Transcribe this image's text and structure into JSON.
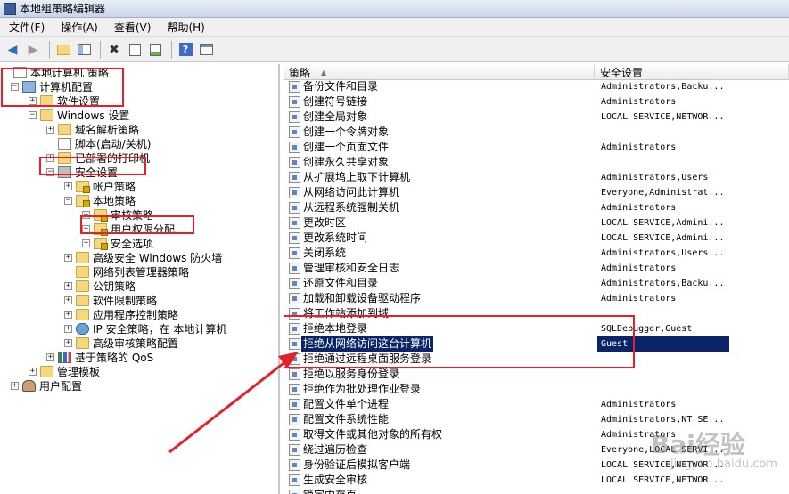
{
  "window": {
    "title": "本地组策略编辑器"
  },
  "menu": [
    "文件(F)",
    "操作(A)",
    "查看(V)",
    "帮助(H)"
  ],
  "toolbar_icons": [
    "back-arrow-icon",
    "forward-arrow-icon",
    "up-folder-icon",
    "show-hide-tree-icon",
    "delete-icon",
    "properties-icon",
    "export-list-icon",
    "help-icon",
    "view-icon"
  ],
  "tree": [
    {
      "label": "本地计算机 策略",
      "depth": 0,
      "expander": "",
      "icon": "doc"
    },
    {
      "label": "计算机配置",
      "depth": 1,
      "expander": "−",
      "icon": "pc"
    },
    {
      "label": "软件设置",
      "depth": 2,
      "expander": "+",
      "icon": "folder"
    },
    {
      "label": "Windows 设置",
      "depth": 2,
      "expander": "−",
      "icon": "folder"
    },
    {
      "label": "域名解析策略",
      "depth": 3,
      "expander": "+",
      "icon": "folder"
    },
    {
      "label": "脚本(启动/关机)",
      "depth": 3,
      "expander": "",
      "icon": "doc"
    },
    {
      "label": "已部署的打印机",
      "depth": 3,
      "expander": "+",
      "icon": "folder"
    },
    {
      "label": "安全设置",
      "depth": 3,
      "expander": "−",
      "icon": "shield"
    },
    {
      "label": "帐户策略",
      "depth": 4,
      "expander": "+",
      "icon": "folder-lock"
    },
    {
      "label": "本地策略",
      "depth": 4,
      "expander": "−",
      "icon": "folder-lock"
    },
    {
      "label": "审核策略",
      "depth": 5,
      "expander": "+",
      "icon": "folder-lock"
    },
    {
      "label": "用户权限分配",
      "depth": 5,
      "expander": "+",
      "icon": "folder-lock"
    },
    {
      "label": "安全选项",
      "depth": 5,
      "expander": "+",
      "icon": "folder-lock"
    },
    {
      "label": "高级安全 Windows 防火墙",
      "depth": 4,
      "expander": "+",
      "icon": "folder"
    },
    {
      "label": "网络列表管理器策略",
      "depth": 4,
      "expander": "",
      "icon": "folder"
    },
    {
      "label": "公钥策略",
      "depth": 4,
      "expander": "+",
      "icon": "folder"
    },
    {
      "label": "软件限制策略",
      "depth": 4,
      "expander": "+",
      "icon": "folder"
    },
    {
      "label": "应用程序控制策略",
      "depth": 4,
      "expander": "+",
      "icon": "folder"
    },
    {
      "label": "IP 安全策略，在 本地计算机",
      "depth": 4,
      "expander": "+",
      "icon": "globe"
    },
    {
      "label": "高级审核策略配置",
      "depth": 4,
      "expander": "+",
      "icon": "folder"
    },
    {
      "label": "基于策略的 QoS",
      "depth": 3,
      "expander": "+",
      "icon": "chart"
    },
    {
      "label": "管理模板",
      "depth": 2,
      "expander": "+",
      "icon": "folder"
    },
    {
      "label": "用户配置",
      "depth": 1,
      "expander": "+",
      "icon": "user"
    }
  ],
  "list": {
    "columns": [
      "策略",
      "安全设置"
    ],
    "rows": [
      {
        "name": "备份文件和目录",
        "value": "Administrators,Backu..."
      },
      {
        "name": "创建符号链接",
        "value": "Administrators"
      },
      {
        "name": "创建全局对象",
        "value": "LOCAL SERVICE,NETWOR..."
      },
      {
        "name": "创建一个令牌对象",
        "value": ""
      },
      {
        "name": "创建一个页面文件",
        "value": "Administrators"
      },
      {
        "name": "创建永久共享对象",
        "value": ""
      },
      {
        "name": "从扩展坞上取下计算机",
        "value": "Administrators,Users"
      },
      {
        "name": "从网络访问此计算机",
        "value": "Everyone,Administrat..."
      },
      {
        "name": "从远程系统强制关机",
        "value": "Administrators"
      },
      {
        "name": "更改时区",
        "value": "LOCAL SERVICE,Admini..."
      },
      {
        "name": "更改系统时间",
        "value": "LOCAL SERVICE,Admini..."
      },
      {
        "name": "关闭系统",
        "value": "Administrators,Users..."
      },
      {
        "name": "管理审核和安全日志",
        "value": "Administrators"
      },
      {
        "name": "还原文件和目录",
        "value": "Administrators,Backu..."
      },
      {
        "name": "加载和卸载设备驱动程序",
        "value": "Administrators"
      },
      {
        "name": "将工作站添加到域",
        "value": ""
      },
      {
        "name": "拒绝本地登录",
        "value": "SQLDebugger,Guest"
      },
      {
        "name": "拒绝从网络访问这台计算机",
        "value": "Guest",
        "selected": true
      },
      {
        "name": "拒绝通过远程桌面服务登录",
        "value": ""
      },
      {
        "name": "拒绝以服务身份登录",
        "value": ""
      },
      {
        "name": "拒绝作为批处理作业登录",
        "value": ""
      },
      {
        "name": "配置文件单个进程",
        "value": "Administrators"
      },
      {
        "name": "配置文件系统性能",
        "value": "Administrators,NT SE..."
      },
      {
        "name": "取得文件或其他对象的所有权",
        "value": "Administrators"
      },
      {
        "name": "绕过遍历检查",
        "value": "Everyone,LOCAL SERVI..."
      },
      {
        "name": "身份验证后模拟客户端",
        "value": "LOCAL SERVICE,NETWOR..."
      },
      {
        "name": "生成安全审核",
        "value": "LOCAL SERVICE,NETWOR..."
      },
      {
        "name": "锁定内存页",
        "value": ""
      }
    ]
  },
  "colors": {
    "highlight": "#e5202a",
    "selection": "#0a246a"
  },
  "watermark": {
    "text": "Bai经验",
    "sub": "jingyan.baidu.com"
  }
}
